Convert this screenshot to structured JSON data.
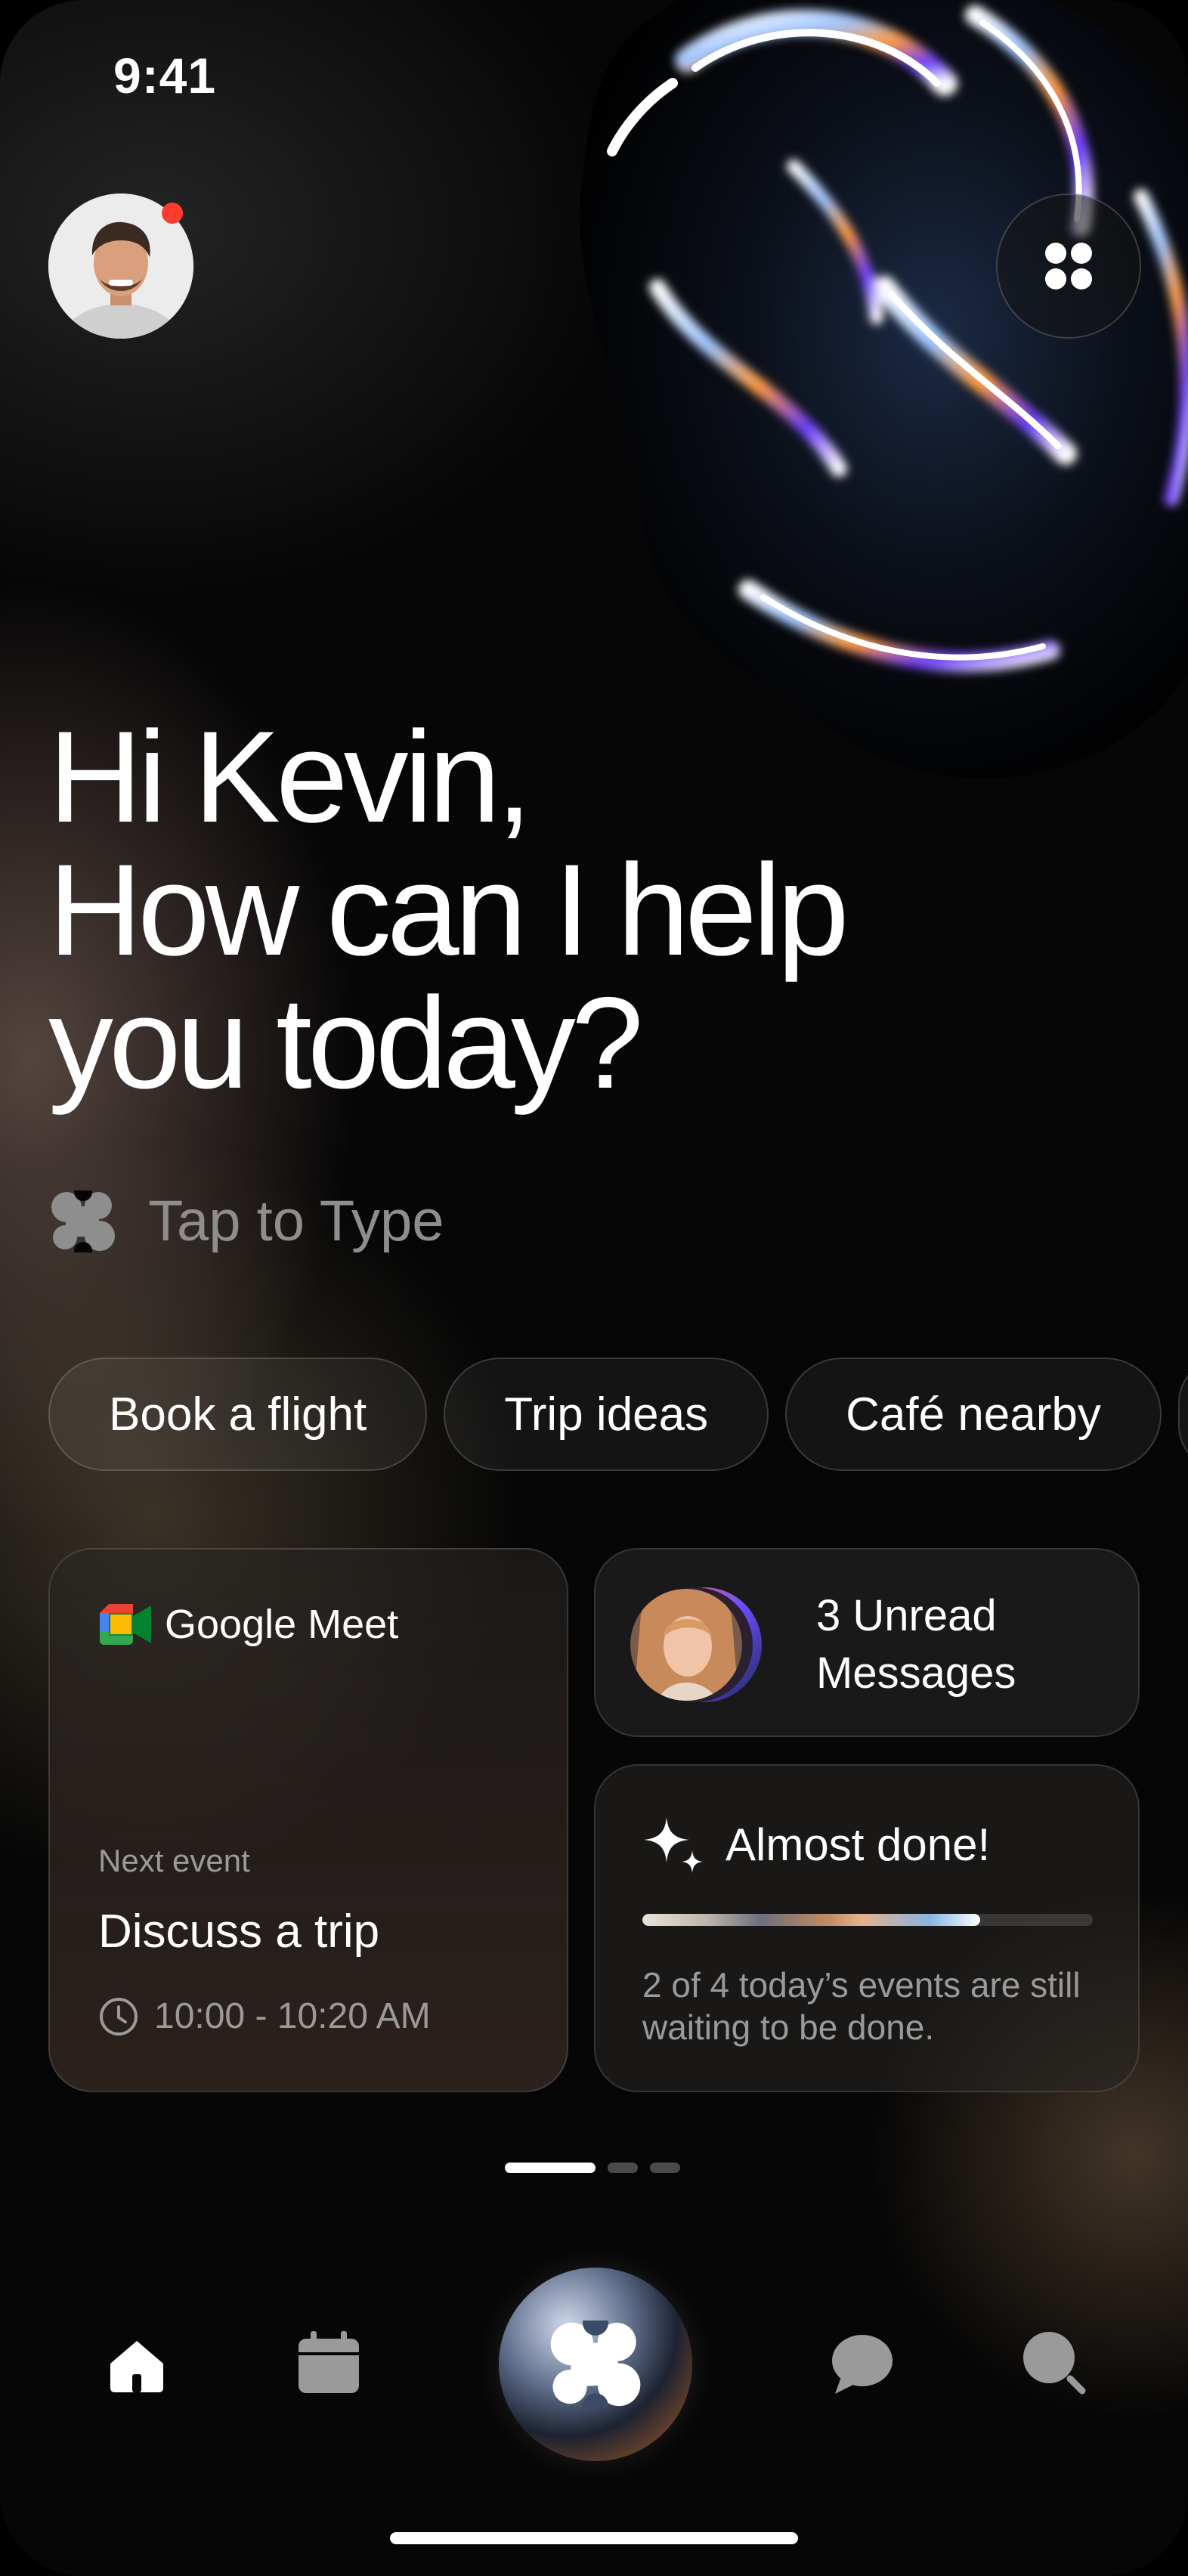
{
  "status_bar": {
    "time": "9:41"
  },
  "colors": {
    "notification_dot": "#ff3b30",
    "background": "#060606",
    "muted_text": "#9a9a9a"
  },
  "header": {
    "avatar_icon": "user-avatar",
    "apps_icon": "four-dots-grid-icon"
  },
  "greeting": {
    "line1": "Hi Kevin,",
    "line2": "How can I help",
    "line3": "you today?"
  },
  "input": {
    "label": "Tap to Type",
    "icon": "assistant-logo-icon"
  },
  "chips": [
    "Book a flight",
    "Trip ideas",
    "Café nearby"
  ],
  "meet_card": {
    "app_name": "Google Meet",
    "next_label": "Next event",
    "title": "Discuss a trip",
    "time": "10:00 - 10:20 AM"
  },
  "messages_card": {
    "line1": "3 Unread",
    "line2": "Messages"
  },
  "progress_card": {
    "title": "Almost done!",
    "progress": 0.75,
    "description": "2 of 4 today’s events are still waiting to be done."
  },
  "pager": {
    "count": 3,
    "active": 0
  },
  "tab_bar": [
    "home-icon",
    "calendar-icon",
    "assistant-icon",
    "chat-icon",
    "search-icon"
  ]
}
